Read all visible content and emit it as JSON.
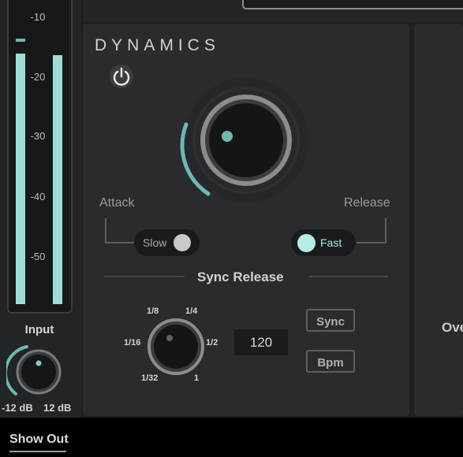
{
  "meter": {
    "scale": [
      "-10",
      "-20",
      "-30",
      "-40",
      "-50"
    ],
    "input_label": "Input",
    "input_min": "-12 dB",
    "input_max": "12 dB",
    "accent": "#9fdcd6"
  },
  "dynamics": {
    "title": "DYNAMICS",
    "power_icon": "power-icon",
    "attack_label": "Attack",
    "release_label": "Release",
    "slow_label": "Slow",
    "fast_label": "Fast",
    "sync_release_label": "Sync Release",
    "divisions": [
      "1/8",
      "1/4",
      "1/16",
      "1/2",
      "1/32",
      "1"
    ],
    "bpm_value": "120",
    "sync_button": "Sync",
    "bpm_button": "Bpm",
    "accent": "#6fb8b2"
  },
  "right_panel": {
    "label": "Ove"
  },
  "footer": {
    "show_out": "Show Out"
  }
}
